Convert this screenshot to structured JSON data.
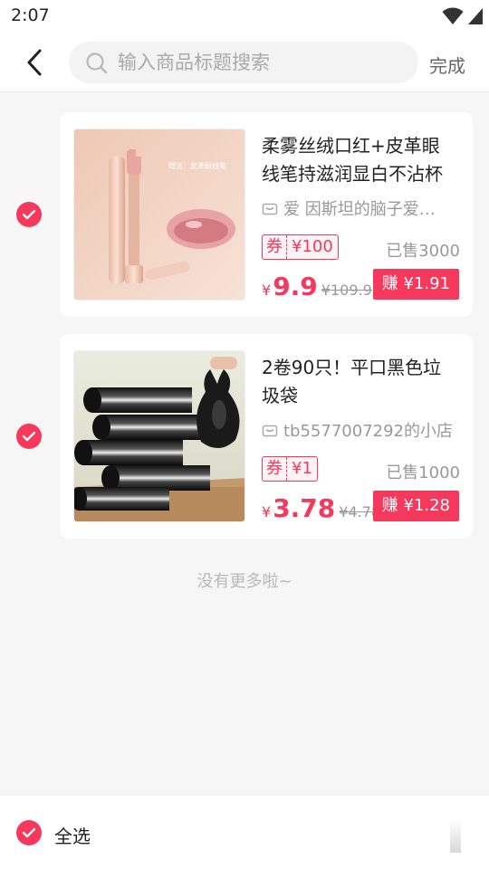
{
  "status_bar": {
    "time": "2:07",
    "icons": [
      "wifi-icon",
      "signal-icon",
      "battery-charging-icon"
    ]
  },
  "header": {
    "back_icon": "chevron-left-icon",
    "search_placeholder": "输入商品标题搜索",
    "search_value": "",
    "done_label": "完成"
  },
  "products": [
    {
      "checked": true,
      "image": "lipstick-product-image",
      "title": "柔雾丝绒口红+皮革眼线笔持滋润显白不沾杯",
      "shop": "爱 因斯坦的脑子爱…",
      "coupon_label": "券",
      "coupon_value": "¥100",
      "sold": "已售3000",
      "price_symbol": "¥",
      "price": "9.9",
      "original_price": "¥109.9",
      "earn": "赚 ¥1.91",
      "image_caption": "赠送：皮革眼线笔"
    },
    {
      "checked": true,
      "image": "trash-bag-product-image",
      "title": "2卷90只！平口黑色垃圾袋",
      "shop": "tb5577007292的小店",
      "coupon_label": "券",
      "coupon_value": "¥1",
      "sold": "已售1000",
      "price_symbol": "¥",
      "price": "3.78",
      "original_price": "¥4.78",
      "earn": "赚 ¥1.28"
    }
  ],
  "list_end_text": "没有更多啦~",
  "bottom_bar": {
    "select_all_checked": true,
    "select_all_label": "全选"
  },
  "colors": {
    "accent": "#f6385c",
    "background": "#f6f6f6",
    "card": "#ffffff",
    "muted_text": "#999999"
  }
}
